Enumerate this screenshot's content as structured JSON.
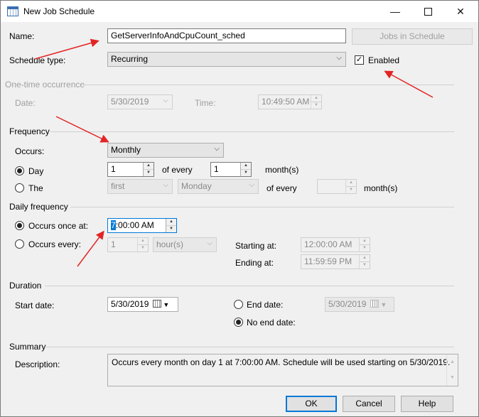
{
  "window": {
    "title": "New Job Schedule"
  },
  "form": {
    "name_label": "Name:",
    "name_value": "GetServerInfoAndCpuCount_sched",
    "jobs_in_schedule": "Jobs in Schedule",
    "schedule_type_label": "Schedule type:",
    "schedule_type_value": "Recurring",
    "enabled_label": "Enabled",
    "enabled_checked": true
  },
  "one_time": {
    "header": "One-time occurrence",
    "date_label": "Date:",
    "date_value": "5/30/2019",
    "time_label": "Time:",
    "time_value": "10:49:50 AM"
  },
  "frequency": {
    "header": "Frequency",
    "occurs_label": "Occurs:",
    "occurs_value": "Monthly",
    "day_label": "Day",
    "day_value": "1",
    "of_every_label": "of every",
    "every_value": "1",
    "months_label": "month(s)",
    "the_label": "The",
    "the_ordinal": "first",
    "the_weekday": "Monday",
    "the_of_every_label": "of every",
    "the_every_value": "",
    "the_months_label": "month(s)"
  },
  "daily": {
    "header": "Daily frequency",
    "once_label": "Occurs once at:",
    "once_value_selected": "7",
    "once_value_rest": ":00:00 AM",
    "every_label": "Occurs every:",
    "every_value": "1",
    "every_unit": "hour(s)",
    "starting_label": "Starting at:",
    "starting_value": "12:00:00 AM",
    "ending_label": "Ending at:",
    "ending_value": "11:59:59 PM"
  },
  "duration": {
    "header": "Duration",
    "start_label": "Start date:",
    "start_value": "5/30/2019",
    "end_label": "End date:",
    "end_value": "5/30/2019",
    "no_end_label": "No end date:"
  },
  "summary": {
    "header": "Summary",
    "description_label": "Description:",
    "description_text": "Occurs every month on day 1 at 7:00:00 AM. Schedule will be used starting on 5/30/2019."
  },
  "buttons": {
    "ok": "OK",
    "cancel": "Cancel",
    "help": "Help"
  },
  "colors": {
    "annotation_arrow": "#e32424",
    "accent": "#0078d7"
  }
}
